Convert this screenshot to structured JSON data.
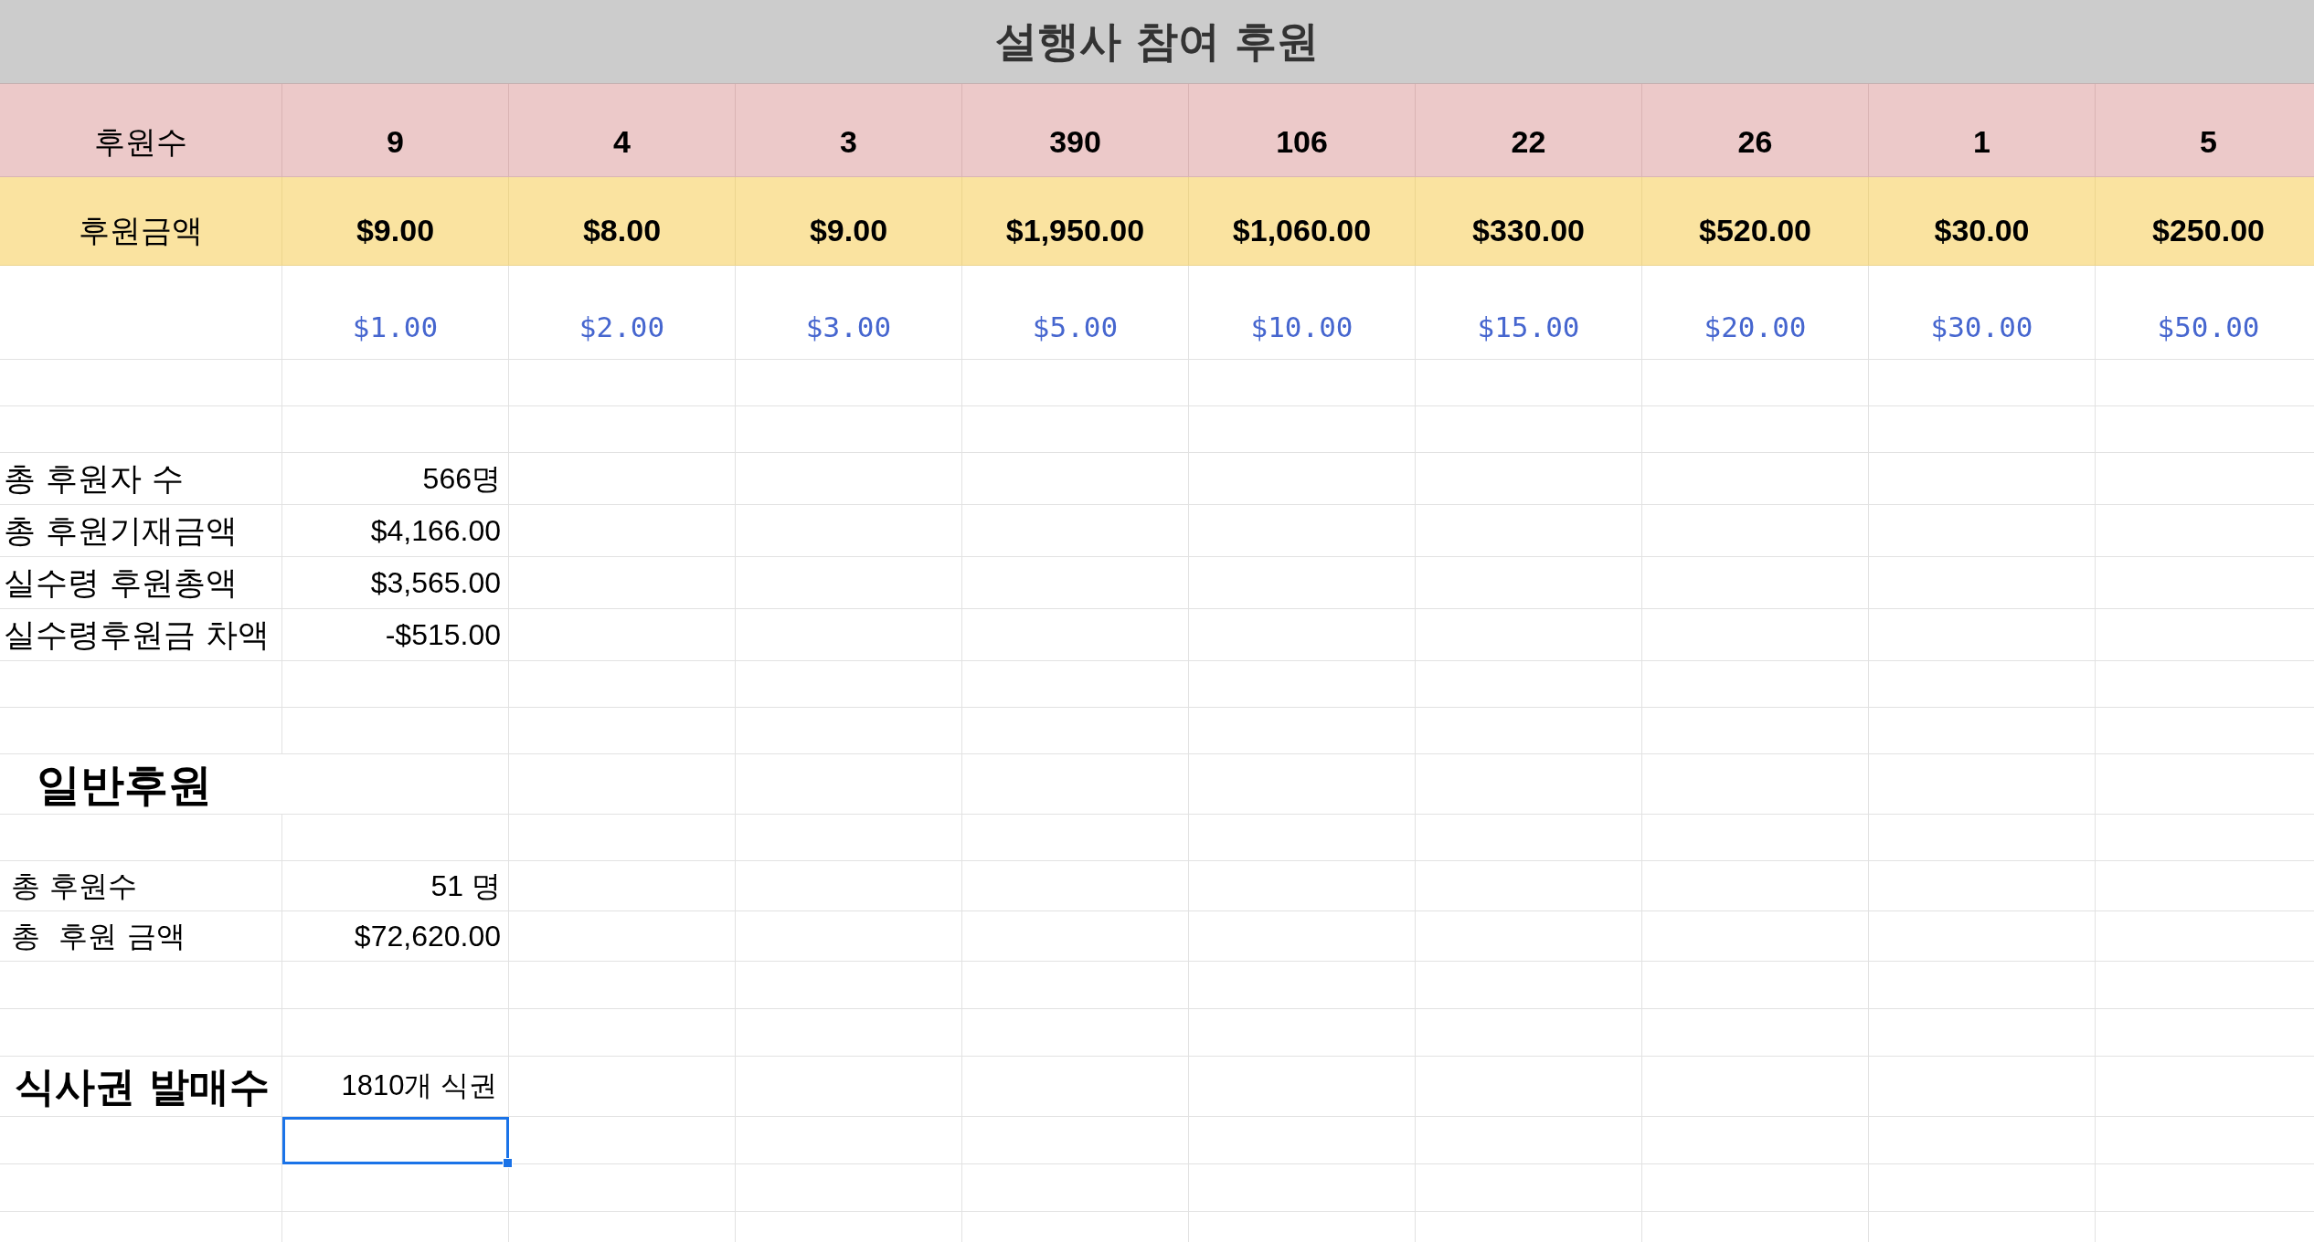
{
  "title": "설행사 참여 후원",
  "count_row": {
    "label": "후원수",
    "values": [
      "9",
      "4",
      "3",
      "390",
      "106",
      "22",
      "26",
      "1",
      "5"
    ]
  },
  "amount_row": {
    "label": "후원금액",
    "values": [
      "$9.00",
      "$8.00",
      "$9.00",
      "$1,950.00",
      "$1,060.00",
      "$330.00",
      "$520.00",
      "$30.00",
      "$250.00"
    ]
  },
  "tier_row": {
    "values": [
      "$1.00",
      "$2.00",
      "$3.00",
      "$5.00",
      "$10.00",
      "$15.00",
      "$20.00",
      "$30.00",
      "$50.00"
    ]
  },
  "summary": [
    {
      "label": "총 후원자 수",
      "value": "566명"
    },
    {
      "label": "총 후원기재금액",
      "value": "$4,166.00"
    },
    {
      "label": "실수령 후원총액",
      "value": "$3,565.00"
    },
    {
      "label": "실수령후원금 차액",
      "value": "-$515.00"
    }
  ],
  "section_heading": "일반후원",
  "general": [
    {
      "label": "총 후원수",
      "value": "51 명"
    },
    {
      "label": "총  후원 금액",
      "value": "$72,620.00"
    }
  ],
  "meal": {
    "label": "식사권 발매수",
    "value": "1810개 식권"
  },
  "active_cell": {
    "selected": true
  }
}
